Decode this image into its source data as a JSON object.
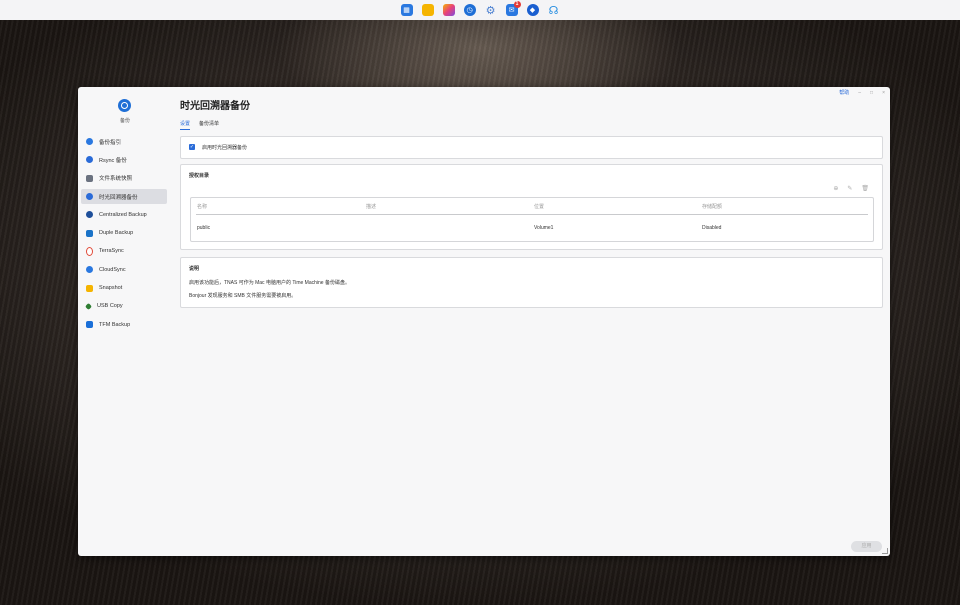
{
  "taskbar": {
    "icons": [
      {
        "name": "grid-app-icon",
        "color": "#2a78e0"
      },
      {
        "name": "folder-icon",
        "color": "#f5b400"
      },
      {
        "name": "photos-icon",
        "color": "#e8417a"
      },
      {
        "name": "backup-clock-icon",
        "color": "#1f6fd6"
      },
      {
        "name": "settings-gear-icon",
        "color": "#4a7fd0"
      },
      {
        "name": "mail-icon",
        "color": "#2a78e0",
        "badge": "1"
      },
      {
        "name": "cube-app-icon",
        "color": "#1a5fd0"
      },
      {
        "name": "headset-icon",
        "color": "#1f8ae0"
      }
    ]
  },
  "window": {
    "help_label": "帮助",
    "minimize_glyph": "–",
    "maximize_glyph": "□",
    "close_glyph": "×"
  },
  "sidebar": {
    "app_label": "备份",
    "items": [
      {
        "label": "备份指引",
        "icon": "guide-icon",
        "color": "#2a78e0"
      },
      {
        "label": "Rsync 备份",
        "icon": "rsync-icon",
        "color": "#2a6bd8"
      },
      {
        "label": "文件系统快照",
        "icon": "snapshot-fs-icon",
        "color": "#6b7280"
      },
      {
        "label": "时光回溯器备份",
        "icon": "time-machine-icon",
        "color": "#2a6bd8"
      },
      {
        "label": "Centralized Backup",
        "icon": "centralized-backup-icon",
        "color": "#1e4f9a"
      },
      {
        "label": "Duple Backup",
        "icon": "duple-backup-icon",
        "color": "#1a73c8"
      },
      {
        "label": "TerraSync",
        "icon": "terrasync-icon",
        "color": "#e04b3a"
      },
      {
        "label": "CloudSync",
        "icon": "cloudsync-icon",
        "color": "#2a78e0"
      },
      {
        "label": "Snapshot",
        "icon": "snapshot-icon",
        "color": "#f5b400"
      },
      {
        "label": "USB Copy",
        "icon": "usb-copy-icon",
        "color": "#2e7d32"
      },
      {
        "label": "TFM Backup",
        "icon": "tfm-backup-icon",
        "color": "#1a6fd8"
      }
    ]
  },
  "main": {
    "title": "时光回溯器备份",
    "tabs": [
      "设置",
      "备份清单"
    ],
    "enable_label": "启用时光回溯器备份",
    "shared_folder": {
      "title": "授权目录",
      "columns": [
        "名称",
        "描述",
        "位置",
        "存储配额"
      ],
      "rows": [
        {
          "name": "public",
          "description": "",
          "location": "Volume1",
          "quota": "Disabled"
        }
      ]
    },
    "notes": {
      "title": "说明",
      "lines": [
        "启用该功能后，TNAS 可作为 Mac 电脑用户的 Time Machine 备份磁盘。",
        "Bonjour 发现服务和 SMB 文件服务需要被启用。"
      ]
    },
    "apply_label": "应用"
  }
}
